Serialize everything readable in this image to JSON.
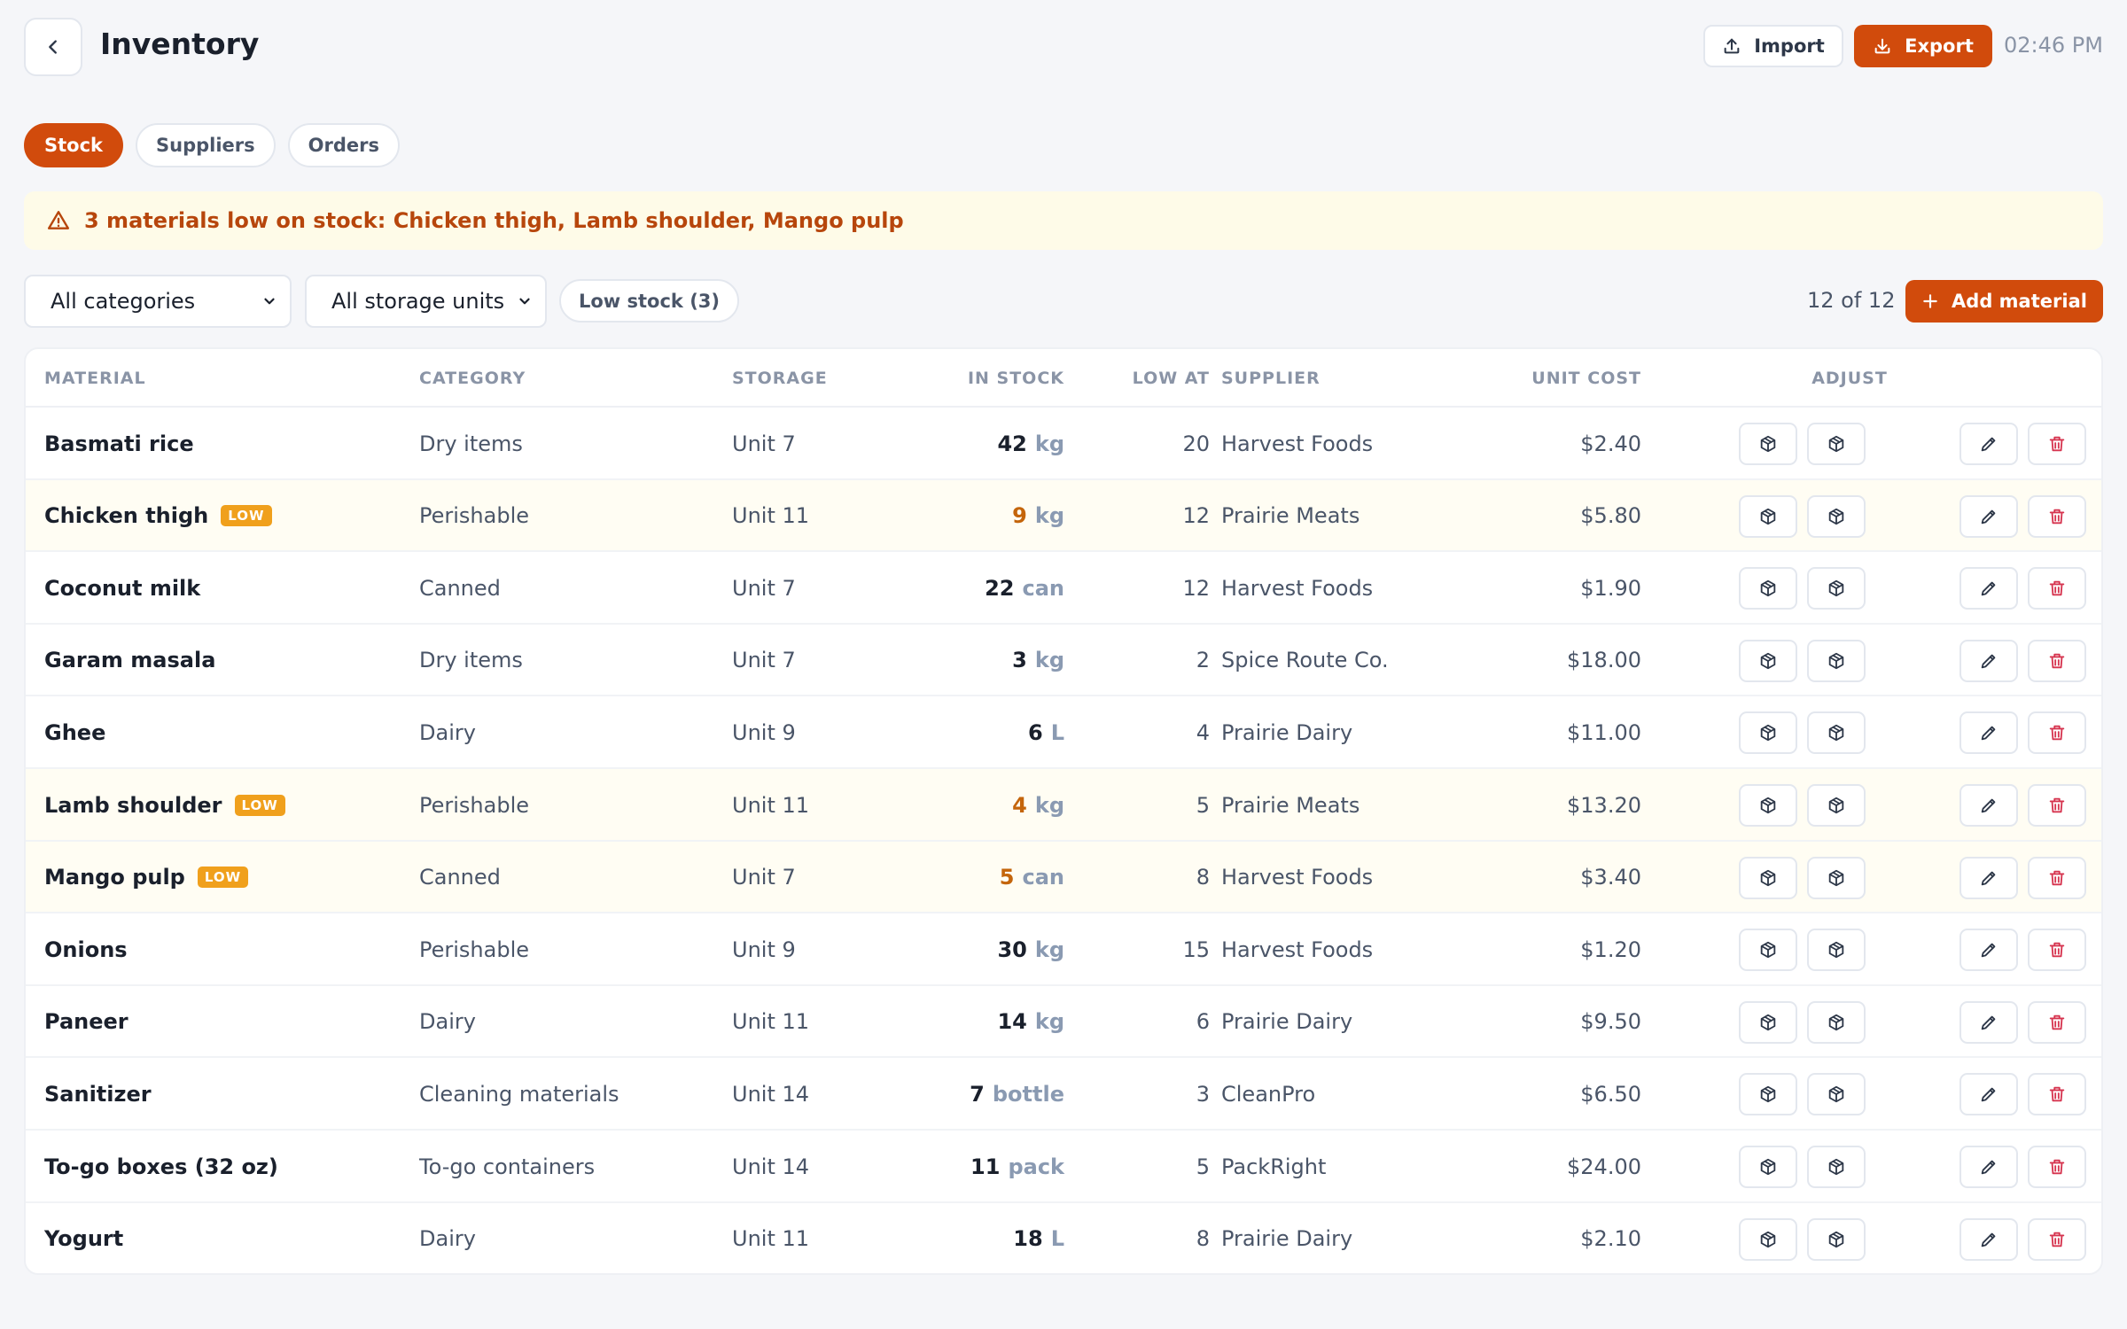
{
  "header": {
    "title": "Inventory",
    "import_label": "Import",
    "export_label": "Export",
    "time": "02:46 PM"
  },
  "tabs": [
    {
      "label": "Stock",
      "active": true
    },
    {
      "label": "Suppliers",
      "active": false
    },
    {
      "label": "Orders",
      "active": false
    }
  ],
  "alert": {
    "text": "3 materials low on stock: Chicken thigh, Lamb shoulder, Mango pulp"
  },
  "filters": {
    "category": "All categories",
    "storage": "All storage units",
    "low_stock_chip": "Low stock (3)",
    "count": "12 of 12",
    "add_label": "Add material"
  },
  "table": {
    "columns": {
      "material": "MATERIAL",
      "category": "CATEGORY",
      "storage": "STORAGE",
      "in_stock": "IN STOCK",
      "low_at": "LOW AT",
      "supplier": "SUPPLIER",
      "unit_cost": "UNIT COST",
      "adjust": "ADJUST"
    },
    "low_badge": "LOW",
    "rows": [
      {
        "name": "Basmati rice",
        "low": false,
        "category": "Dry items",
        "storage": "Unit 7",
        "qty": "42",
        "unit": "kg",
        "low_at": "20",
        "supplier": "Harvest Foods",
        "cost": "$2.40"
      },
      {
        "name": "Chicken thigh",
        "low": true,
        "category": "Perishable",
        "storage": "Unit 11",
        "qty": "9",
        "unit": "kg",
        "low_at": "12",
        "supplier": "Prairie Meats",
        "cost": "$5.80"
      },
      {
        "name": "Coconut milk",
        "low": false,
        "category": "Canned",
        "storage": "Unit 7",
        "qty": "22",
        "unit": "can",
        "low_at": "12",
        "supplier": "Harvest Foods",
        "cost": "$1.90"
      },
      {
        "name": "Garam masala",
        "low": false,
        "category": "Dry items",
        "storage": "Unit 7",
        "qty": "3",
        "unit": "kg",
        "low_at": "2",
        "supplier": "Spice Route Co.",
        "cost": "$18.00"
      },
      {
        "name": "Ghee",
        "low": false,
        "category": "Dairy",
        "storage": "Unit 9",
        "qty": "6",
        "unit": "L",
        "low_at": "4",
        "supplier": "Prairie Dairy",
        "cost": "$11.00"
      },
      {
        "name": "Lamb shoulder",
        "low": true,
        "category": "Perishable",
        "storage": "Unit 11",
        "qty": "4",
        "unit": "kg",
        "low_at": "5",
        "supplier": "Prairie Meats",
        "cost": "$13.20"
      },
      {
        "name": "Mango pulp",
        "low": true,
        "category": "Canned",
        "storage": "Unit 7",
        "qty": "5",
        "unit": "can",
        "low_at": "8",
        "supplier": "Harvest Foods",
        "cost": "$3.40"
      },
      {
        "name": "Onions",
        "low": false,
        "category": "Perishable",
        "storage": "Unit 9",
        "qty": "30",
        "unit": "kg",
        "low_at": "15",
        "supplier": "Harvest Foods",
        "cost": "$1.20"
      },
      {
        "name": "Paneer",
        "low": false,
        "category": "Dairy",
        "storage": "Unit 11",
        "qty": "14",
        "unit": "kg",
        "low_at": "6",
        "supplier": "Prairie Dairy",
        "cost": "$9.50"
      },
      {
        "name": "Sanitizer",
        "low": false,
        "category": "Cleaning materials",
        "storage": "Unit 14",
        "qty": "7",
        "unit": "bottle",
        "low_at": "3",
        "supplier": "CleanPro",
        "cost": "$6.50"
      },
      {
        "name": "To-go boxes (32 oz)",
        "low": false,
        "category": "To-go containers",
        "storage": "Unit 14",
        "qty": "11",
        "unit": "pack",
        "low_at": "5",
        "supplier": "PackRight",
        "cost": "$24.00"
      },
      {
        "name": "Yogurt",
        "low": false,
        "category": "Dairy",
        "storage": "Unit 11",
        "qty": "18",
        "unit": "L",
        "low_at": "8",
        "supplier": "Prairie Dairy",
        "cost": "$2.10"
      }
    ]
  },
  "colors": {
    "accent": "#d14b0c",
    "low_badge": "#f0a01c",
    "alert_bg": "#fefbe8",
    "alert_text": "#b7460c",
    "delete": "#d6344f"
  }
}
